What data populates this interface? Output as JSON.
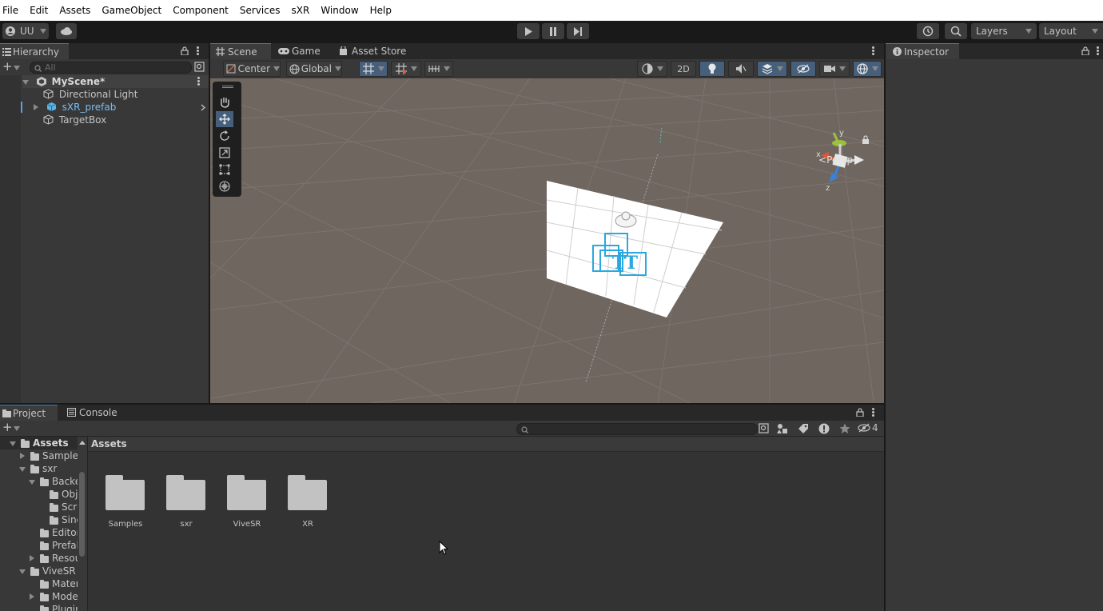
{
  "menu": [
    "File",
    "Edit",
    "Assets",
    "GameObject",
    "Component",
    "Services",
    "sXR",
    "Window",
    "Help"
  ],
  "toolbar": {
    "account": "UU",
    "layers": "Layers",
    "layout": "Layout"
  },
  "hierarchy": {
    "tab": "Hierarchy",
    "search_placeholder": "All",
    "scene": "MyScene*",
    "items": [
      "Directional Light",
      "sXR_prefab",
      "TargetBox"
    ]
  },
  "scene_tabs": [
    "Scene",
    "Game",
    "Asset Store"
  ],
  "scene_toolbar": {
    "pivot": "Center",
    "space": "Global",
    "mode2d": "2D"
  },
  "gizmo": {
    "persp": "Persp",
    "y": "y",
    "x": "x",
    "z": "z"
  },
  "inspector": {
    "tab": "Inspector"
  },
  "project": {
    "tabs": [
      "Project",
      "Console"
    ],
    "hidden_count": "4",
    "breadcrumb": "Assets",
    "tree": [
      {
        "label": "Assets",
        "depth": 0,
        "arrow": "down"
      },
      {
        "label": "Samples",
        "depth": 1,
        "arrow": "right"
      },
      {
        "label": "sxr",
        "depth": 1,
        "arrow": "down"
      },
      {
        "label": "Backend",
        "depth": 2,
        "arrow": "down"
      },
      {
        "label": "Objects",
        "depth": 3,
        "arrow": ""
      },
      {
        "label": "Scripts",
        "depth": 3,
        "arrow": ""
      },
      {
        "label": "Singletons",
        "depth": 3,
        "arrow": ""
      },
      {
        "label": "Editor",
        "depth": 2,
        "arrow": ""
      },
      {
        "label": "Prefabs",
        "depth": 2,
        "arrow": ""
      },
      {
        "label": "Resources",
        "depth": 2,
        "arrow": "right"
      },
      {
        "label": "ViveSR",
        "depth": 1,
        "arrow": "down"
      },
      {
        "label": "Materials",
        "depth": 2,
        "arrow": ""
      },
      {
        "label": "Models",
        "depth": 2,
        "arrow": "right"
      },
      {
        "label": "Plugins",
        "depth": 2,
        "arrow": ""
      }
    ],
    "folders": [
      "Samples",
      "sxr",
      "ViveSR",
      "XR"
    ]
  }
}
